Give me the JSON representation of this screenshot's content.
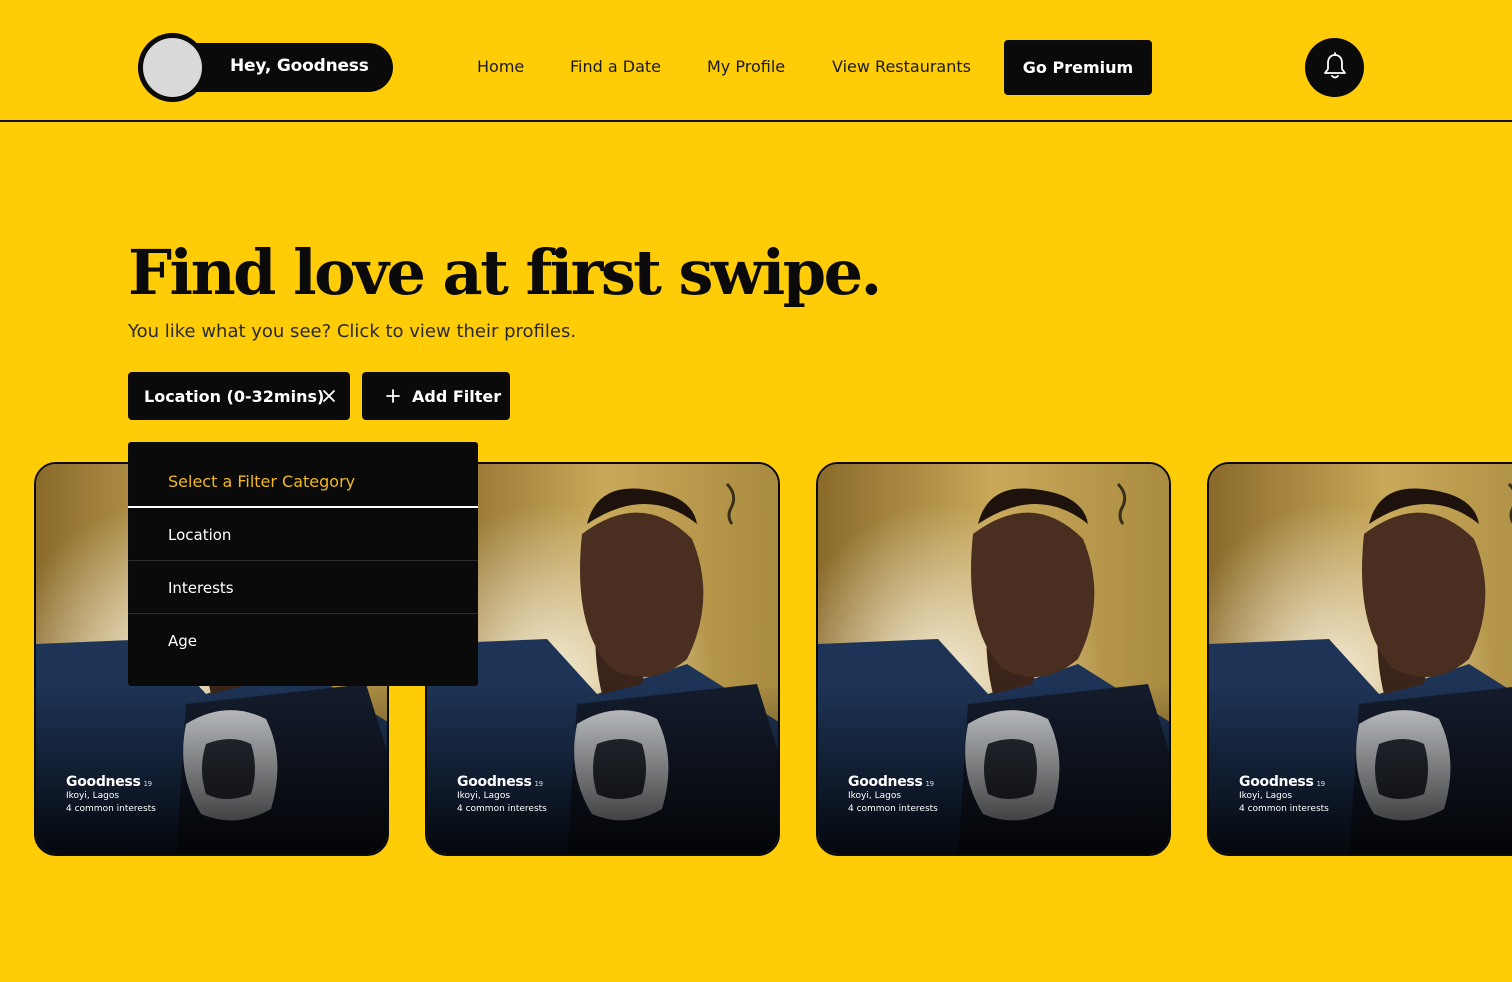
{
  "colors": {
    "background": "#FFCC08",
    "dark": "#0a0a0a",
    "dropdown_header": "#F2B81D"
  },
  "header": {
    "greeting": "Hey, Goodness",
    "nav": {
      "home": "Home",
      "find_date": "Find a Date",
      "my_profile": "My Profile",
      "view_restaurants": "View Restaurants"
    },
    "premium_label": "Go Premium",
    "notification_icon": "bell-icon"
  },
  "hero": {
    "title": "Find love at first swipe.",
    "subtitle": "You like what you see? Click to view their profiles."
  },
  "filters": {
    "active_chip": "Location (0-32mins)",
    "add_label": "Add Filter"
  },
  "dropdown": {
    "header": "Select a Filter Category",
    "items": [
      "Location",
      "Interests",
      "Age"
    ]
  },
  "cards": [
    {
      "name": "Goodness",
      "age": "19",
      "location": "Ikoyi, Lagos",
      "common": "4 common interests"
    },
    {
      "name": "Goodness",
      "age": "19",
      "location": "Ikoyi, Lagos",
      "common": "4 common interests"
    },
    {
      "name": "Goodness",
      "age": "19",
      "location": "Ikoyi, Lagos",
      "common": "4 common interests"
    },
    {
      "name": "Goodness",
      "age": "19",
      "location": "Ikoyi, Lagos",
      "common": "4 common interests"
    }
  ]
}
